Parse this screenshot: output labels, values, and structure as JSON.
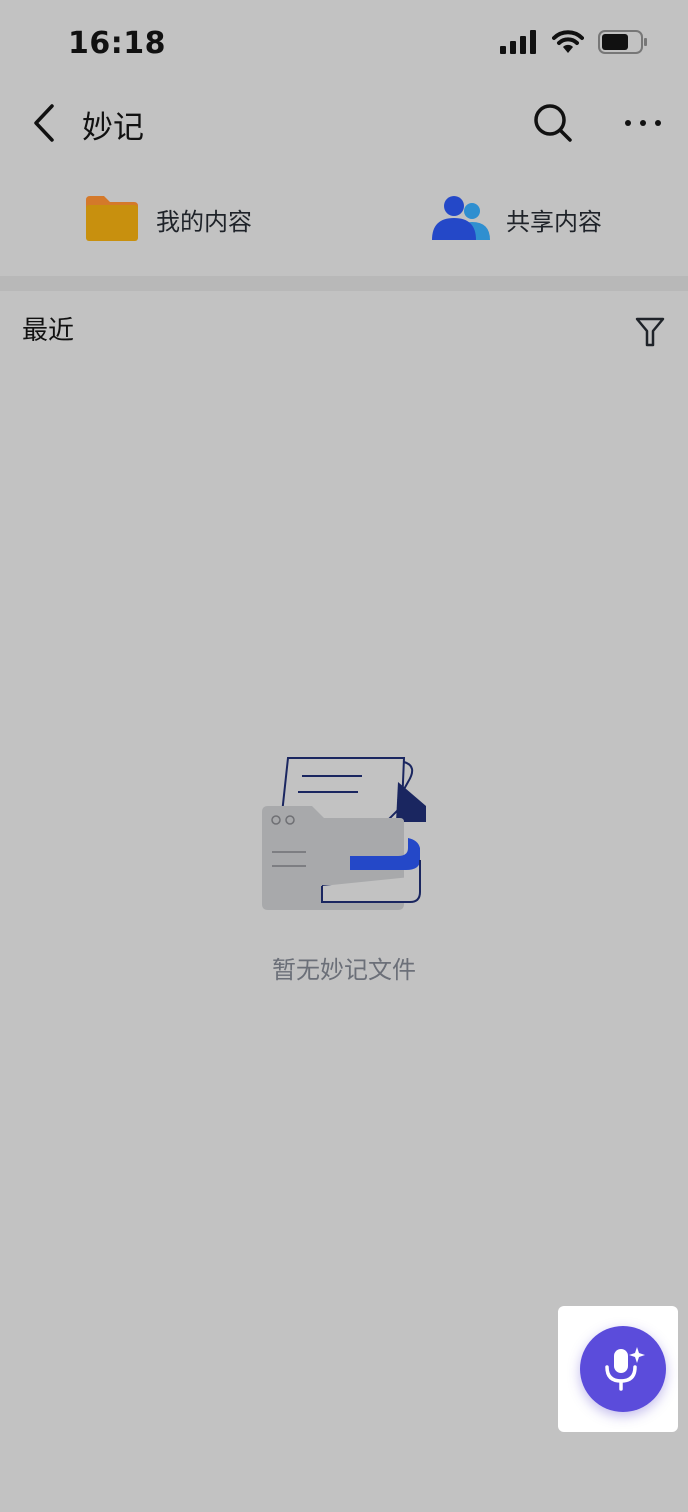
{
  "status_bar": {
    "time": "16:18",
    "icons": [
      "signal-icon",
      "wifi-icon",
      "battery-icon"
    ]
  },
  "nav": {
    "title": "妙记",
    "back_icon": "chevron-left-icon",
    "search_icon": "search-icon",
    "more_icon": "more-horizontal-icon"
  },
  "quick_access": [
    {
      "label": "我的内容",
      "icon": "folder-icon",
      "color": "#c8900e"
    },
    {
      "label": "共享内容",
      "icon": "people-icon",
      "color": "#2448c8"
    }
  ],
  "recent": {
    "title": "最近",
    "filter_icon": "filter-icon"
  },
  "empty_state": {
    "message": "暂无妙记文件",
    "illustration": "empty-folder-illustration"
  },
  "fab": {
    "icon": "microphone-sparkle-icon",
    "color": "#5b4cdb"
  }
}
